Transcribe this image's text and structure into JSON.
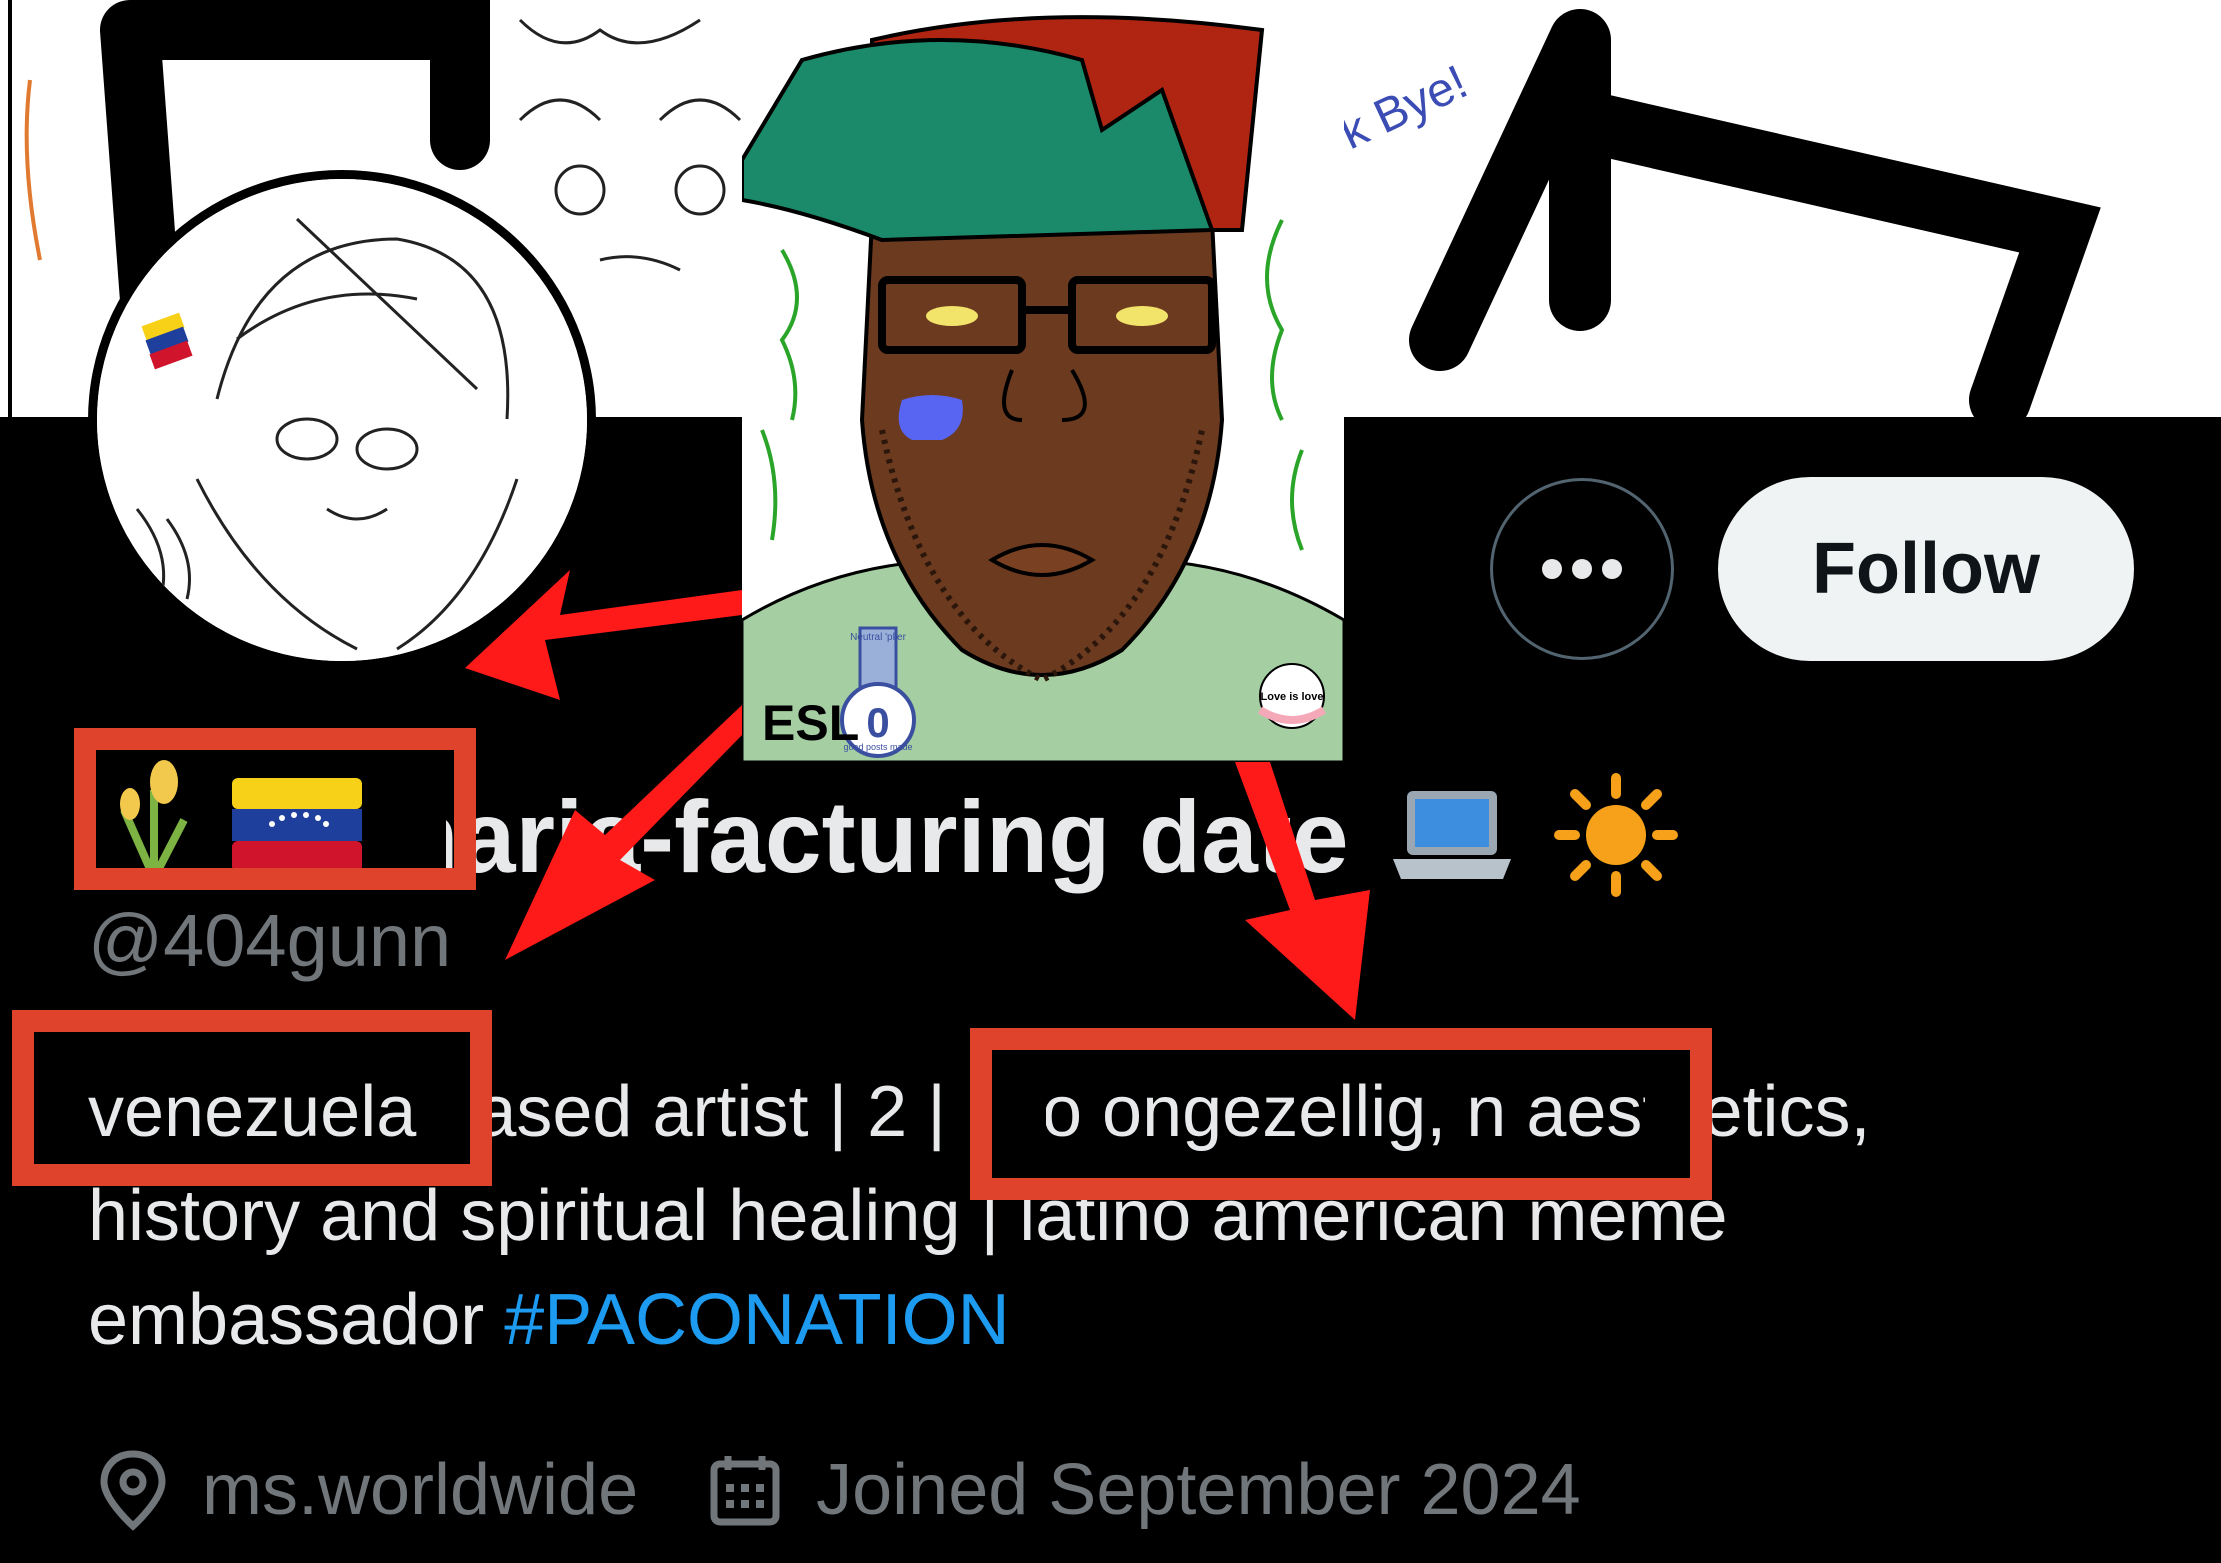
{
  "profile": {
    "display_name": "maria-facturing date",
    "handle": "@404gunn",
    "bio": {
      "line1_a": "venezuela",
      "line1_b": " based artist | 2",
      "line1_c": " | into ongezellig, n",
      "line1_d": " aesthetics,",
      "line2": "history and spiritual healing | latino american meme",
      "line3_text": "embassador ",
      "hashtag": "#PACONATION"
    },
    "location": "ms.worldwide",
    "joined": "Joined September 2024",
    "follow_label": "Follow",
    "more_icon": "more-horizontal-icon"
  },
  "meme": {
    "esl_label": "ESL",
    "badge_top": "Neutral 'plier",
    "badge_number": "0",
    "badge_bottom": "good posts made",
    "love_badge": "Love is love",
    "banner_scribble": "k Bye!"
  },
  "colors": {
    "follow_bg": "#eff3f4",
    "hashtag": "#1d9bf0",
    "annotation_red": "#e0432b",
    "arrow_red": "#ff1a1a"
  }
}
